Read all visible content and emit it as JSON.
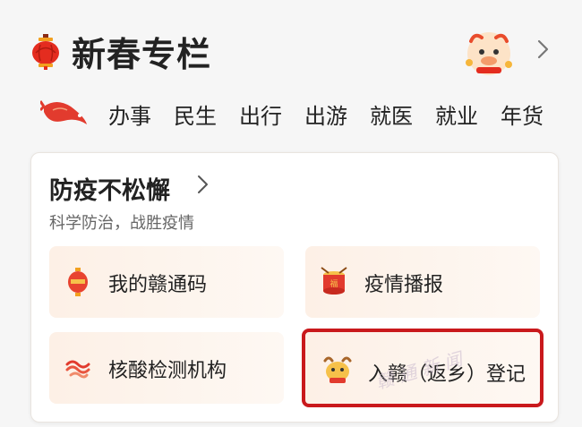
{
  "header": {
    "title": "新春专栏",
    "icons": {
      "left": "lantern-icon",
      "mascot": "ox-mascot-icon",
      "more": "chevron-right-icon"
    }
  },
  "nav": {
    "icon": "koi-fish-icon",
    "items": [
      "办事",
      "民生",
      "出行",
      "出游",
      "就医",
      "就业",
      "年货"
    ]
  },
  "card": {
    "title": "防疫不松懈",
    "subtitle": "科学防治，战胜疫情",
    "tiles": [
      {
        "label": "我的赣通码",
        "icon": "lantern-small-icon"
      },
      {
        "label": "疫情播报",
        "icon": "drum-icon"
      },
      {
        "label": "核酸检测机构",
        "icon": "swirl-icon"
      },
      {
        "label": "入赣（返乡）登记",
        "icon": "ox-small-icon",
        "highlighted": true
      }
    ]
  },
  "colors": {
    "accent": "#c9191c",
    "tile_bg": "#fdf0e6",
    "fish": "#e23b2e"
  },
  "watermark": "赣 通 新 闻"
}
